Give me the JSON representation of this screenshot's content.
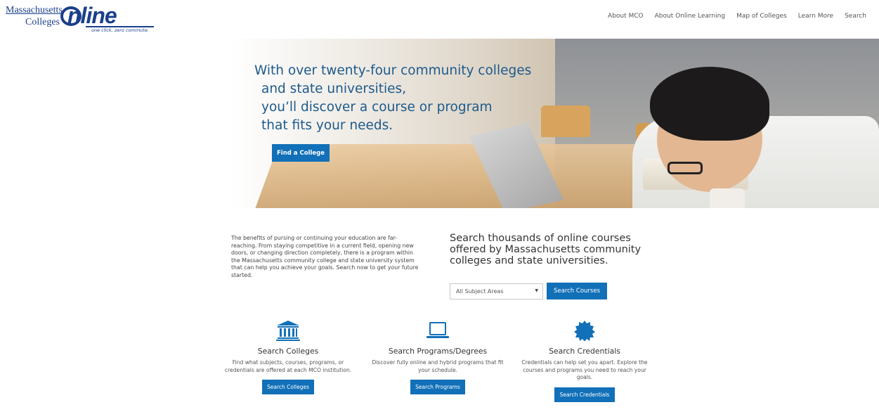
{
  "logo": {
    "line1": "Massachusetts",
    "line2": "Colleges",
    "word": "nline",
    "tagline": "one click, zero commute."
  },
  "nav": [
    {
      "label": "About MCO"
    },
    {
      "label": "About Online Learning"
    },
    {
      "label": "Map of Colleges"
    },
    {
      "label": "Learn More"
    },
    {
      "label": "Search"
    }
  ],
  "hero": {
    "line1": "With over twenty-four community colleges",
    "line2": "and state universities,",
    "line3": "you’ll discover a course or program",
    "line4": "that fits your needs.",
    "button": "Find a College"
  },
  "intro": {
    "text": "The benefits of pursing or continuing your education are far-reaching. From staying competitive in a current field, opening new doors, or changing direction completely, there is a program within the Massachusetts community college and state university system that can help you achieve your goals. Search now to get your future started."
  },
  "course_search": {
    "heading": "Search thousands of online courses offered by Massachusetts community colleges and state universities.",
    "select_value": "All Subject Areas",
    "button": "Search Courses"
  },
  "columns": [
    {
      "icon": "institution-icon",
      "title": "Search Colleges",
      "text": "Find what subjects, courses, programs, or credentials are offered at each MCO institution.",
      "button": "Search Colleges"
    },
    {
      "icon": "laptop-icon",
      "title": "Search Programs/Degrees",
      "text": "Discover fully online and hybrid programs that fit your schedule.",
      "button": "Search Programs"
    },
    {
      "icon": "badge-icon",
      "title": "Search Credentials",
      "text": "Credentials can help set you apart. Explore the courses and programs you need to reach your goals.",
      "button": "Search Credentials"
    }
  ],
  "colors": {
    "brand_blue": "#1b3f8b",
    "button_blue": "#1170b8",
    "hero_text": "#1d5a8c"
  }
}
